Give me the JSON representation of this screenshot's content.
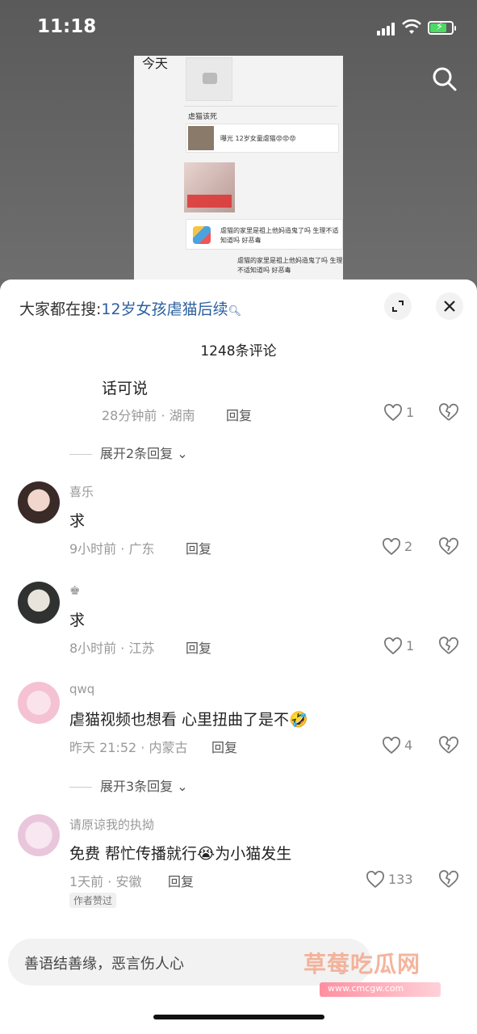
{
  "status": {
    "time": "11:18"
  },
  "video_screenshot": {
    "today_label": "今天",
    "section_label": "虐猫该死",
    "row1_text": "曝光 12岁女童虐猫😡😡😡",
    "row2_text": "虐猫的家里是祖上他妈造鬼了吗 生理不适知道吗 好恶毒",
    "row3_text": "虐猫的家里是祖上他妈造鬼了吗 生理不适知道吗 好恶毒"
  },
  "sheet": {
    "hot_prefix": "大家都在搜:",
    "hot_keyword": "12岁女孩虐猫后续",
    "count_label": "1248条评论"
  },
  "comments": [
    {
      "text": "话可说",
      "meta": "28分钟前 · 湖南",
      "reply": "回复",
      "likes": "1"
    },
    {
      "name": "喜乐",
      "text": "求",
      "meta": "9小时前 · 广东",
      "reply": "回复",
      "likes": "2"
    },
    {
      "name": "♚",
      "text": "求",
      "meta": "8小时前 · 江苏",
      "reply": "回复",
      "likes": "1"
    },
    {
      "name": "qwq",
      "text": "虐猫视频也想看 心里扭曲了是不🤣",
      "meta": "昨天 21:52 · 内蒙古",
      "reply": "回复",
      "likes": "4"
    },
    {
      "name": "请原谅我的执拗",
      "text": "免费 帮忙传播就行😭为小猫发生",
      "meta": "1天前 · 安徽",
      "reply": "回复",
      "likes": "133",
      "badge": "作者赞过"
    }
  ],
  "expand1": "展开2条回复",
  "expand2": "展开3条回复",
  "input": {
    "placeholder": "善语结善缘，恶言伤人心"
  },
  "watermark": {
    "text": "草莓吃瓜网",
    "url": "www.cmcgw.com"
  }
}
